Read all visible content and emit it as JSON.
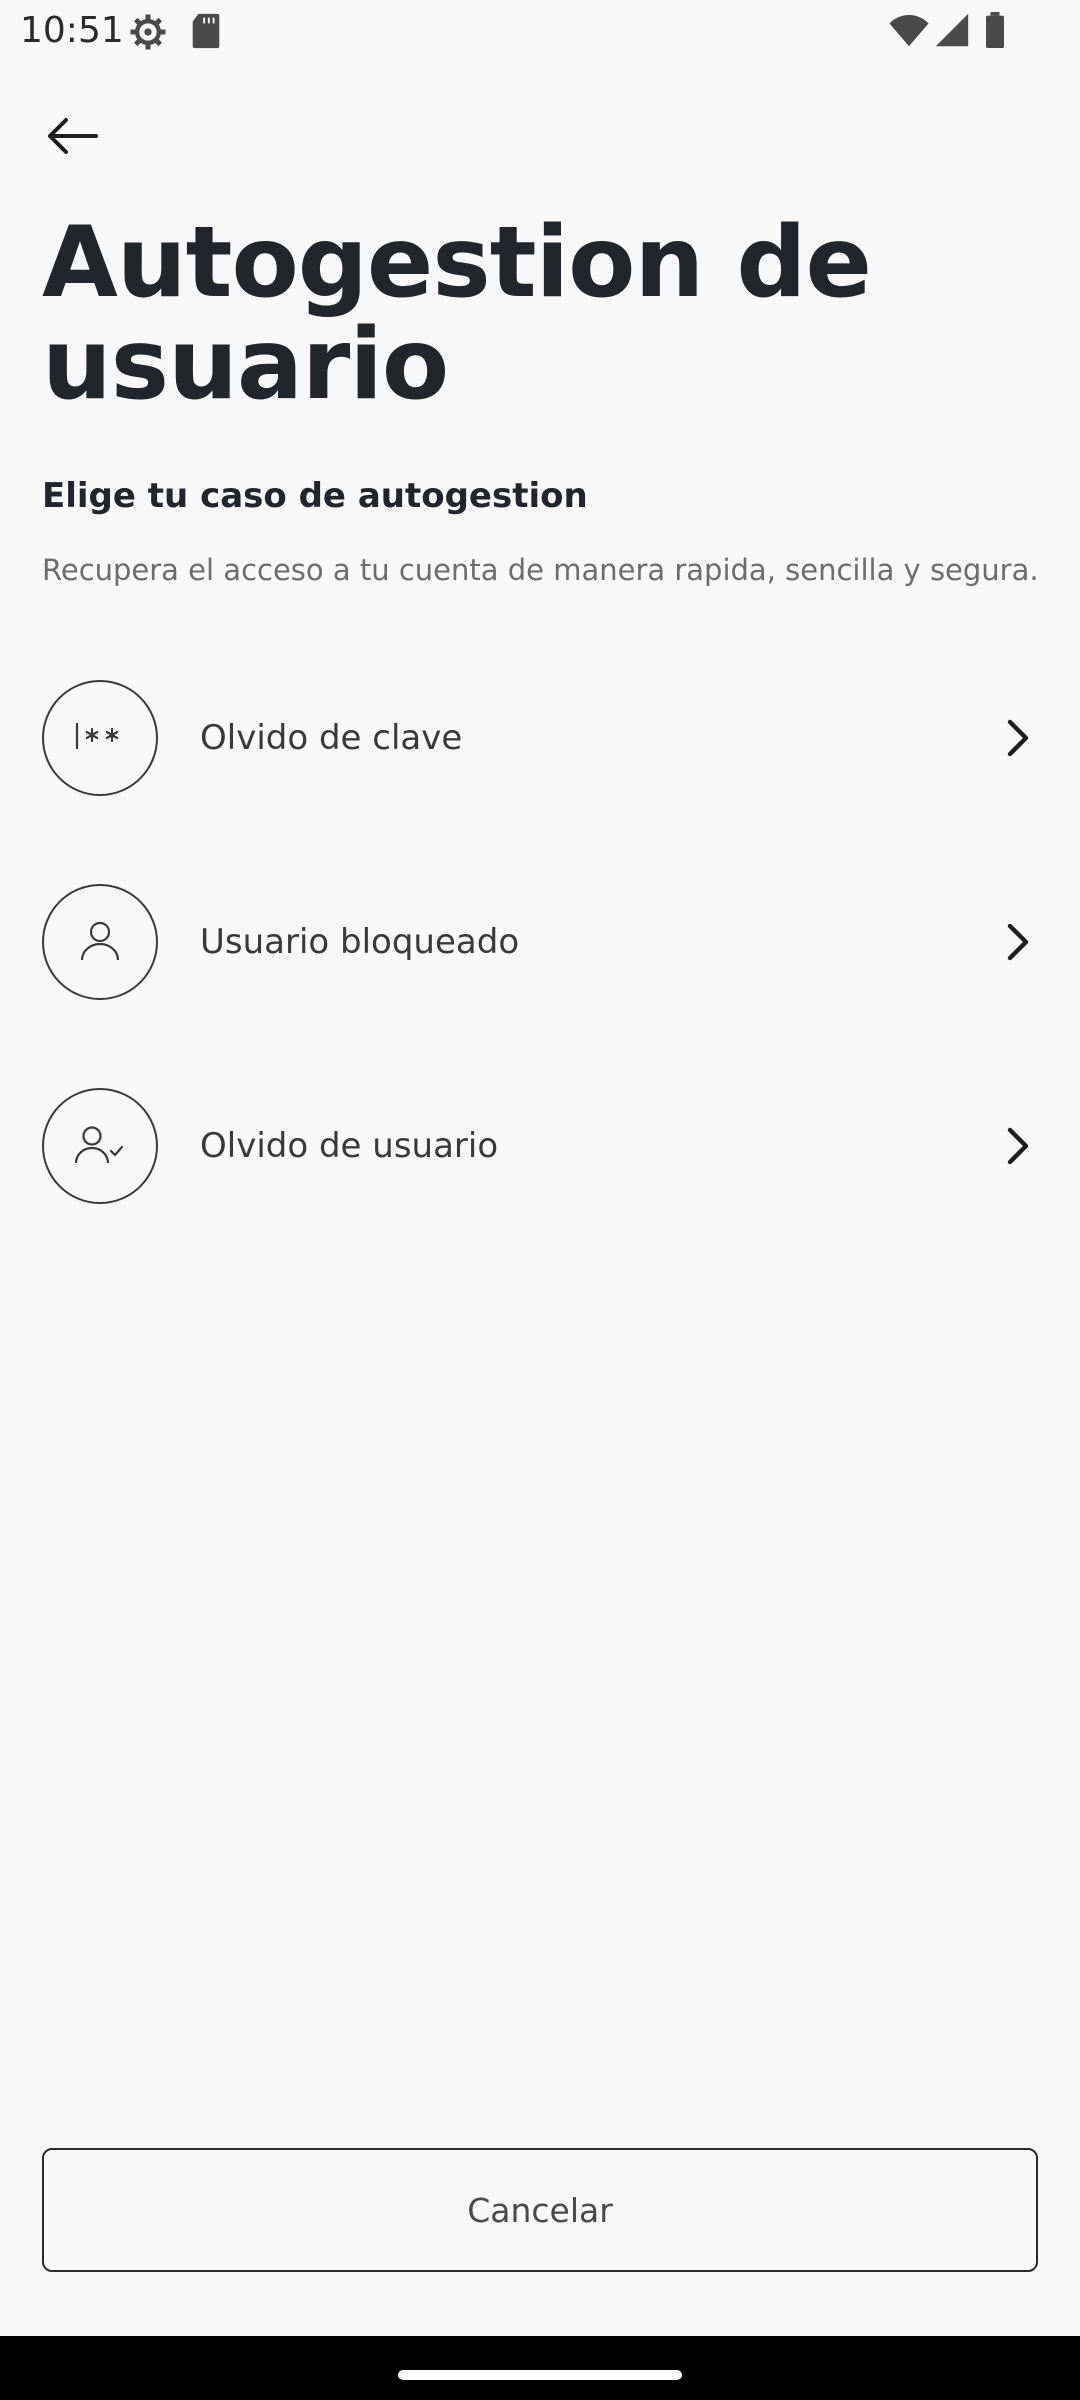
{
  "status_bar": {
    "time": "10:51",
    "icons": [
      "settings-icon",
      "sd-card-icon",
      "wifi-icon",
      "signal-icon",
      "battery-icon"
    ]
  },
  "header": {
    "back_icon": "arrow-left-icon",
    "title": "Autogestion de usuario"
  },
  "section": {
    "heading": "Elige tu caso de autogestion",
    "description": "Recupera el acceso a tu cuenta de manera rapida, sencilla y segura."
  },
  "options": [
    {
      "label": "Olvido de clave",
      "icon": "password-icon"
    },
    {
      "label": "Usuario bloqueado",
      "icon": "user-icon"
    },
    {
      "label": "Olvido de usuario",
      "icon": "user-check-icon"
    }
  ],
  "footer": {
    "cancel_label": "Cancelar"
  },
  "colors": {
    "background": "#f8f8f8",
    "text_primary": "#22262c",
    "text_secondary": "#6d6d6d",
    "border": "#3a3a3a"
  }
}
